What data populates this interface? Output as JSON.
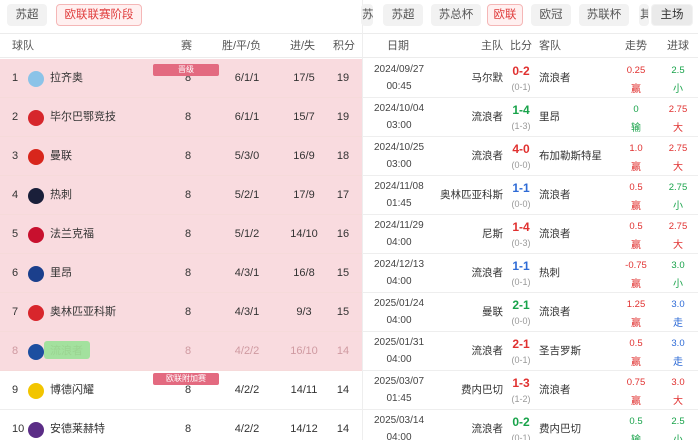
{
  "left_tabs": [
    "苏超",
    "欧联联赛阶段"
  ],
  "standings_header": {
    "team": "球队",
    "played": "赛",
    "wdl": "胜/平/负",
    "goals": "进/失",
    "points": "积分"
  },
  "section_labels": {
    "top": "晋级",
    "playoff": "欧联附加赛"
  },
  "standings": [
    {
      "rank": "1",
      "team": "拉齐奥",
      "played": "8",
      "wdl": "6/1/1",
      "goals": "17/5",
      "points": "19",
      "logo_color": "#8bc3e8"
    },
    {
      "rank": "2",
      "team": "毕尔巴鄂竞技",
      "played": "8",
      "wdl": "6/1/1",
      "goals": "15/7",
      "points": "19",
      "logo_color": "#d6262c"
    },
    {
      "rank": "3",
      "team": "曼联",
      "played": "8",
      "wdl": "5/3/0",
      "goals": "16/9",
      "points": "18",
      "logo_color": "#d8261c"
    },
    {
      "rank": "4",
      "team": "热刺",
      "played": "8",
      "wdl": "5/2/1",
      "goals": "17/9",
      "points": "17",
      "logo_color": "#1a1f3a"
    },
    {
      "rank": "5",
      "team": "法兰克福",
      "played": "8",
      "wdl": "5/1/2",
      "goals": "14/10",
      "points": "16",
      "logo_color": "#c8102e"
    },
    {
      "rank": "6",
      "team": "里昂",
      "played": "8",
      "wdl": "4/3/1",
      "goals": "16/8",
      "points": "15",
      "logo_color": "#1b3f8c"
    },
    {
      "rank": "7",
      "team": "奥林匹亚科斯",
      "played": "8",
      "wdl": "4/3/1",
      "goals": "9/3",
      "points": "15",
      "logo_color": "#d8262c"
    },
    {
      "rank": "8",
      "team": "流浪者",
      "played": "8",
      "wdl": "4/2/2",
      "goals": "16/10",
      "points": "14",
      "logo_color": "#1d4fa0"
    },
    {
      "rank": "9",
      "team": "博德闪耀",
      "played": "8",
      "wdl": "4/2/2",
      "goals": "14/11",
      "points": "14",
      "logo_color": "#f2c500"
    },
    {
      "rank": "10",
      "team": "安德莱赫特",
      "played": "8",
      "wdl": "4/2/2",
      "goals": "14/12",
      "points": "14",
      "logo_color": "#5b2d86"
    }
  ],
  "right_tabs": [
    "苏",
    "苏超",
    "苏总杯",
    "欧联",
    "欧冠",
    "苏联杯",
    "其",
    "主场"
  ],
  "matches_header": {
    "date": "日期",
    "home": "主队",
    "score": "比分",
    "away": "客队",
    "trend": "走势",
    "ou": "进球"
  },
  "matches": [
    {
      "date": "2024/09/27",
      "time": "00:45",
      "home": "马尔默",
      "score": "0-2",
      "ht": "(0-1)",
      "away": "流浪者",
      "hc": "0.25",
      "hc_res": "赢",
      "ou": "2.5",
      "ou_res": "小",
      "score_color": "#e0302f",
      "res_color": "#e0302f",
      "ou_color": "#18a34a"
    },
    {
      "date": "2024/10/04",
      "time": "03:00",
      "home": "流浪者",
      "score": "1-4",
      "ht": "(1-3)",
      "away": "里昂",
      "hc": "0",
      "hc_res": "输",
      "ou": "2.75",
      "ou_res": "大",
      "score_color": "#18a34a",
      "res_color": "#18a34a",
      "ou_color": "#e0302f"
    },
    {
      "date": "2024/10/25",
      "time": "03:00",
      "home": "流浪者",
      "score": "4-0",
      "ht": "(0-0)",
      "away": "布加勒斯特星",
      "hc": "1.0",
      "hc_res": "赢",
      "ou": "2.75",
      "ou_res": "大",
      "score_color": "#e0302f",
      "res_color": "#e0302f",
      "ou_color": "#e0302f"
    },
    {
      "date": "2024/11/08",
      "time": "01:45",
      "home": "奥林匹亚科斯",
      "score": "1-1",
      "ht": "(0-0)",
      "away": "流浪者",
      "hc": "0.5",
      "hc_res": "赢",
      "ou": "2.75",
      "ou_res": "小",
      "score_color": "#2e6bd6",
      "res_color": "#e0302f",
      "ou_color": "#18a34a"
    },
    {
      "date": "2024/11/29",
      "time": "04:00",
      "home": "尼斯",
      "score": "1-4",
      "ht": "(0-3)",
      "away": "流浪者",
      "hc": "0.5",
      "hc_res": "赢",
      "ou": "2.75",
      "ou_res": "大",
      "score_color": "#e0302f",
      "res_color": "#e0302f",
      "ou_color": "#e0302f"
    },
    {
      "date": "2024/12/13",
      "time": "04:00",
      "home": "流浪者",
      "score": "1-1",
      "ht": "(0-1)",
      "away": "热刺",
      "hc": "-0.75",
      "hc_res": "赢",
      "ou": "3.0",
      "ou_res": "小",
      "score_color": "#2e6bd6",
      "res_color": "#e0302f",
      "ou_color": "#18a34a"
    },
    {
      "date": "2025/01/24",
      "time": "04:00",
      "home": "曼联",
      "score": "2-1",
      "ht": "(0-0)",
      "away": "流浪者",
      "hc": "1.25",
      "hc_res": "赢",
      "ou": "3.0",
      "ou_res": "走",
      "score_color": "#18a34a",
      "res_color": "#e0302f",
      "ou_color": "#2e6bd6"
    },
    {
      "date": "2025/01/31",
      "time": "04:00",
      "home": "流浪者",
      "score": "2-1",
      "ht": "(0-1)",
      "away": "圣吉罗斯",
      "hc": "0.5",
      "hc_res": "赢",
      "ou": "3.0",
      "ou_res": "走",
      "score_color": "#e0302f",
      "res_color": "#e0302f",
      "ou_color": "#2e6bd6"
    },
    {
      "date": "2025/03/07",
      "time": "01:45",
      "home": "费内巴切",
      "score": "1-3",
      "ht": "(1-2)",
      "away": "流浪者",
      "hc": "0.75",
      "hc_res": "赢",
      "ou": "3.0",
      "ou_res": "大",
      "score_color": "#e0302f",
      "res_color": "#e0302f",
      "ou_color": "#e0302f"
    },
    {
      "date": "2025/03/14",
      "time": "04:00",
      "home": "流浪者",
      "score": "0-2",
      "ht": "(0-1)",
      "away": "费内巴切",
      "hc": "0.5",
      "hc_res": "输",
      "ou": "2.5",
      "ou_res": "小",
      "score_color": "#18a34a",
      "res_color": "#18a34a",
      "ou_color": "#18a34a"
    }
  ]
}
